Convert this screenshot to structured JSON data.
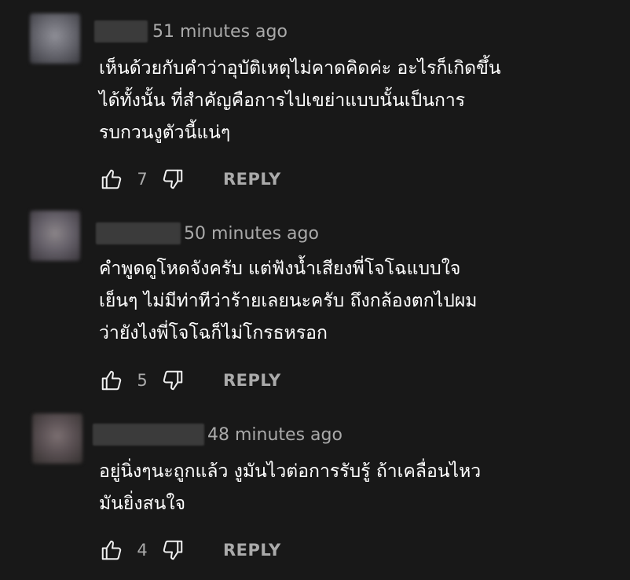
{
  "comments": [
    {
      "time": "51 minutes ago",
      "text": "เห็นด้วยกับคำว่าอุบัติเหตุไม่คาดคิดค่ะ อะไรก็เกิดขึ้น\nได้ทั้งนั้น ที่สำคัญคือการไปเขย่าแบบนั้นเป็นการ\nรบกวนงูตัวนี้แน่ๆ",
      "likes": "7",
      "reply_label": "REPLY"
    },
    {
      "time": "50 minutes ago",
      "text": "คำพูดดูโหดจังครับ แต่ฟังน้ำเสียงพี่โจโฉแบบใจ\nเย็นๆ ไม่มีท่าทีว่าร้ายเลยนะครับ ถึงกล้องตกไปผม\nว่ายังไงพี่โจโฉก็ไม่โกรธหรอก",
      "likes": "5",
      "reply_label": "REPLY"
    },
    {
      "time": "48 minutes ago",
      "text": "อยู่นิ่งๆนะถูกแล้ว งูมันไวต่อการรับรู้ ถ้าเคลื่อนไหว\nมันยิ่งสนใจ",
      "likes": "4",
      "reply_label": "REPLY"
    }
  ],
  "colors": {
    "background": "#181818",
    "text": "#ffffff",
    "secondary_text": "#aaaaaa"
  }
}
